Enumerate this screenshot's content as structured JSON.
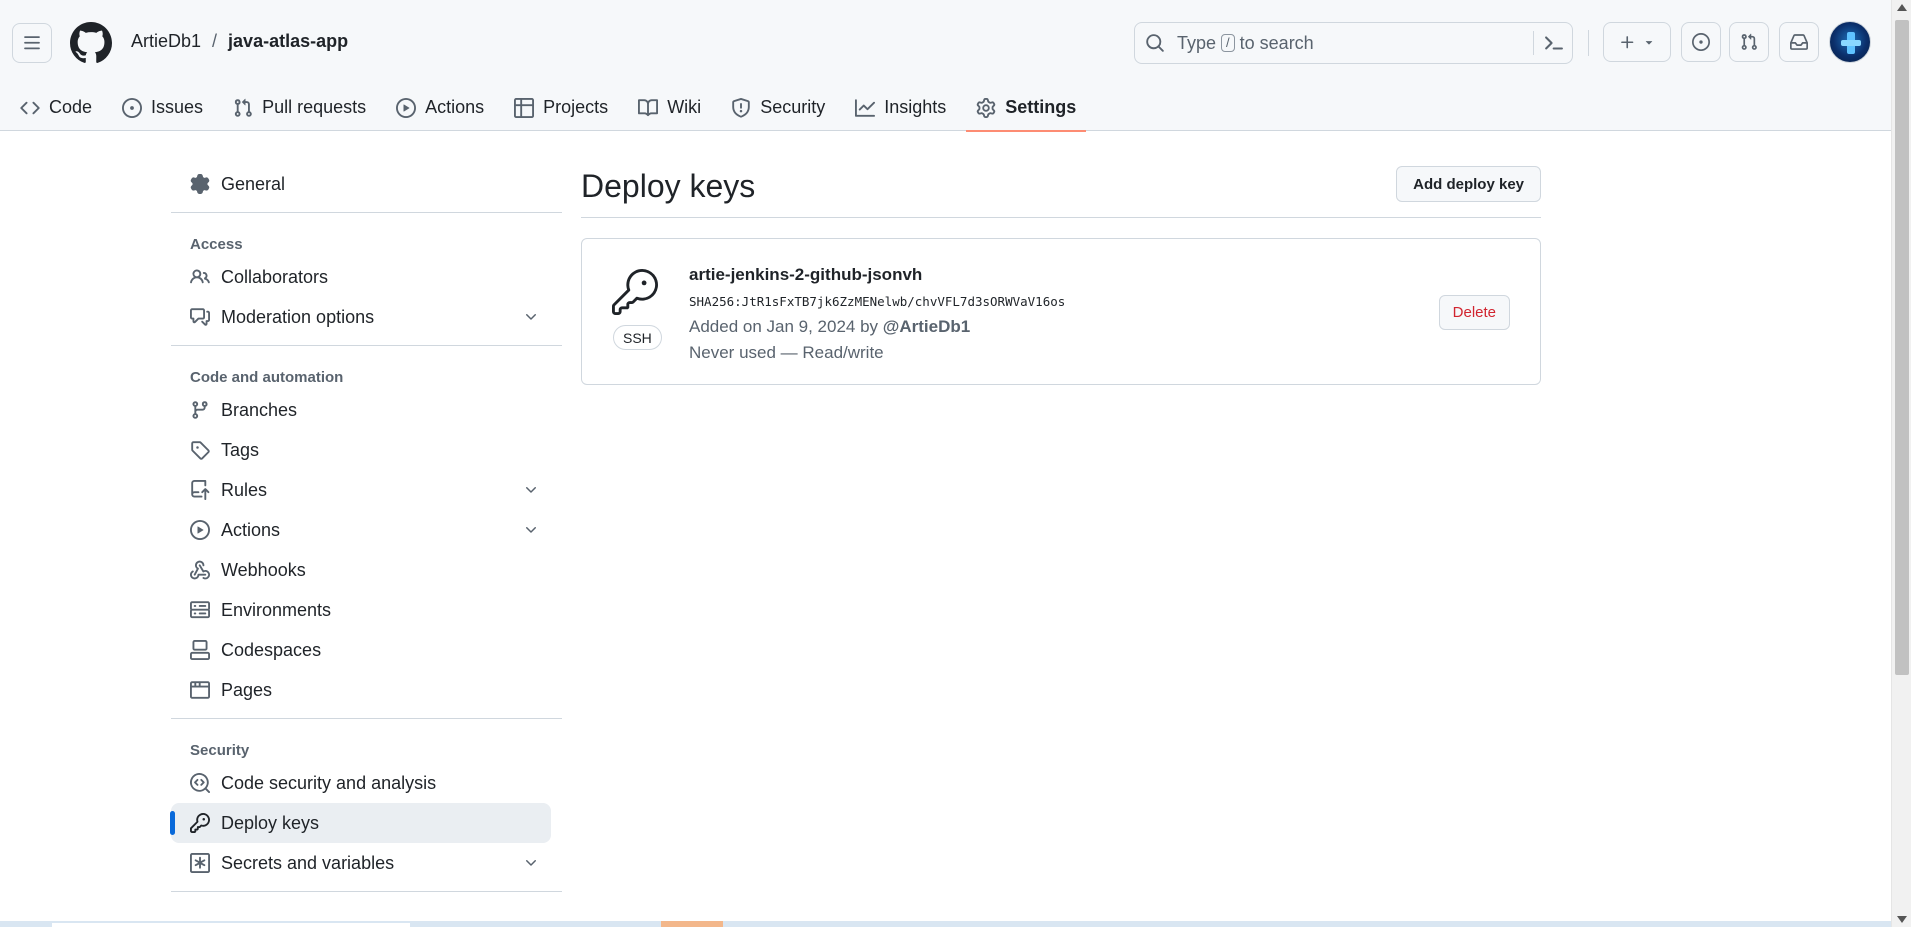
{
  "header": {
    "owner": "ArtieDb1",
    "separator": "/",
    "repo": "java-atlas-app",
    "search": {
      "prefix": "Type",
      "key": "/",
      "suffix": "to search"
    }
  },
  "tabs": [
    {
      "label": "Code",
      "icon": "code-icon"
    },
    {
      "label": "Issues",
      "icon": "issue-icon"
    },
    {
      "label": "Pull requests",
      "icon": "pull-request-icon"
    },
    {
      "label": "Actions",
      "icon": "play-icon"
    },
    {
      "label": "Projects",
      "icon": "table-icon"
    },
    {
      "label": "Wiki",
      "icon": "book-icon"
    },
    {
      "label": "Security",
      "icon": "shield-icon"
    },
    {
      "label": "Insights",
      "icon": "graph-icon"
    },
    {
      "label": "Settings",
      "icon": "gear-icon",
      "active": true
    }
  ],
  "sidebar": {
    "general": "General",
    "access_heading": "Access",
    "collaborators": "Collaborators",
    "moderation": "Moderation options",
    "code_heading": "Code and automation",
    "branches": "Branches",
    "tags": "Tags",
    "rules": "Rules",
    "actions": "Actions",
    "webhooks": "Webhooks",
    "environments": "Environments",
    "codespaces": "Codespaces",
    "pages": "Pages",
    "security_heading": "Security",
    "code_security": "Code security and analysis",
    "deploy_keys": "Deploy keys",
    "secrets": "Secrets and variables"
  },
  "main": {
    "title": "Deploy keys",
    "add_button": "Add deploy key",
    "key": {
      "type": "SSH",
      "title": "artie-jenkins-2-github-jsonvh",
      "fingerprint": "SHA256:JtR1sFxTB7jk6ZzMENelwb/chvVFL7d3sORWVaV16os",
      "added_prefix": "Added on Jan 9, 2024 by",
      "added_by": "@ArtieDb1",
      "usage": "Never used — Read/write",
      "delete_button": "Delete"
    }
  },
  "colors": {
    "accent": "#0969da",
    "active_tab_underline": "#fd8c73",
    "danger": "#d1242f"
  }
}
